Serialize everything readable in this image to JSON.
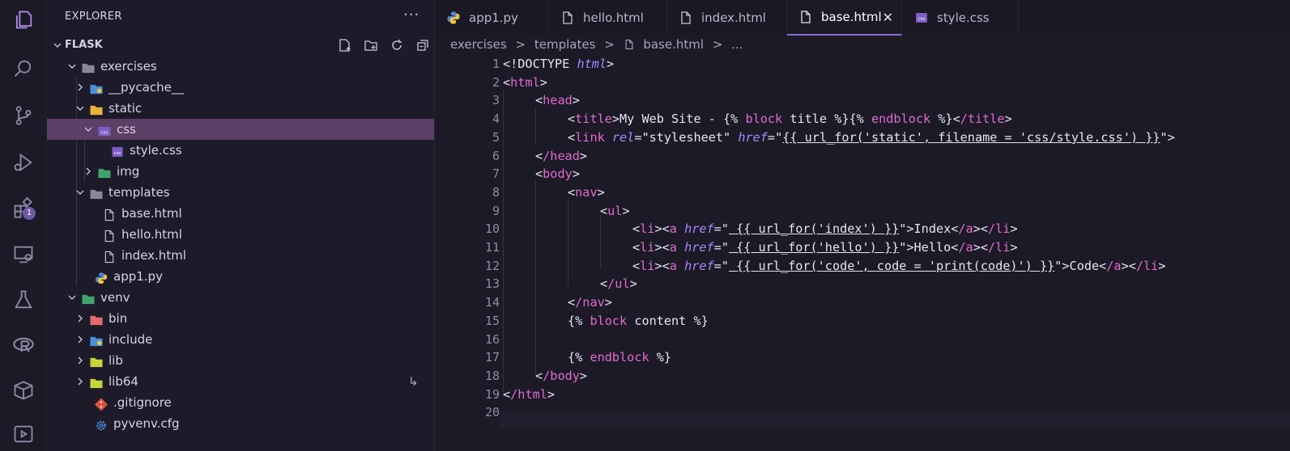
{
  "explorer": {
    "title": "EXPLORER",
    "more": "···",
    "workspace": "FLASK",
    "tree": [
      {
        "label": "exercises",
        "kind": "folder-open"
      },
      {
        "label": "__pycache__",
        "kind": "folder-closed"
      },
      {
        "label": "static",
        "kind": "folder-open"
      },
      {
        "label": "css",
        "kind": "folder-open"
      },
      {
        "label": "style.css",
        "kind": "file"
      },
      {
        "label": "img",
        "kind": "folder-closed"
      },
      {
        "label": "templates",
        "kind": "folder-open"
      },
      {
        "label": "base.html",
        "kind": "file"
      },
      {
        "label": "hello.html",
        "kind": "file"
      },
      {
        "label": "index.html",
        "kind": "file"
      },
      {
        "label": "app1.py",
        "kind": "file"
      },
      {
        "label": "venv",
        "kind": "folder-open"
      },
      {
        "label": "bin",
        "kind": "folder-closed"
      },
      {
        "label": "include",
        "kind": "folder-closed"
      },
      {
        "label": "lib",
        "kind": "folder-closed"
      },
      {
        "label": "lib64",
        "kind": "folder-closed"
      },
      {
        "label": ".gitignore",
        "kind": "file"
      },
      {
        "label": "pyvenv.cfg",
        "kind": "file"
      }
    ],
    "lib64_symbol": "↳"
  },
  "activity": {
    "extensions_badge": "1"
  },
  "tabs": [
    {
      "label": "app1.py",
      "icon": "python-icon"
    },
    {
      "label": "hello.html",
      "icon": "file-icon"
    },
    {
      "label": "index.html",
      "icon": "file-icon"
    },
    {
      "label": "base.html",
      "icon": "file-icon",
      "active": true
    },
    {
      "label": "style.css",
      "icon": "css-icon"
    }
  ],
  "breadcrumbs": [
    "exercises",
    ">",
    "templates",
    ">",
    "base.html",
    ">",
    "..."
  ],
  "line_numbers": [
    "1",
    "2",
    "3",
    "4",
    "5",
    "6",
    "7",
    "8",
    "9",
    "10",
    "11",
    "12",
    "13",
    "14",
    "15",
    "16",
    "17",
    "18",
    "19",
    "20"
  ],
  "code_lines": [
    "<!DOCTYPE html>",
    "<html>",
    "<head>",
    "<title>My Web Site - {% block title %}{% endblock %}</title>",
    "<link rel=\"stylesheet\" href=\"{{ url_for('static', filename = 'css/style.css') }}\">",
    "</head>",
    "<body>",
    "<nav>",
    "<ul>",
    "<li><a href=\" {{ url_for('index') }}\">Index</a></li>",
    "<li><a href=\" {{ url_for('hello') }}\">Hello</a></li>",
    "<li><a href=\" {{ url_for('code', code = 'print(code)') }}\">Code</a></li>",
    "</ul>",
    "</nav>",
    "{% block content %}",
    "",
    "{% endblock %}",
    "</body>",
    "</html>",
    ""
  ],
  "colors": {
    "tag": "#e26bd0",
    "attr": "#a987ff",
    "selection": "#5b3f66",
    "accent": "#8b6bd6"
  }
}
